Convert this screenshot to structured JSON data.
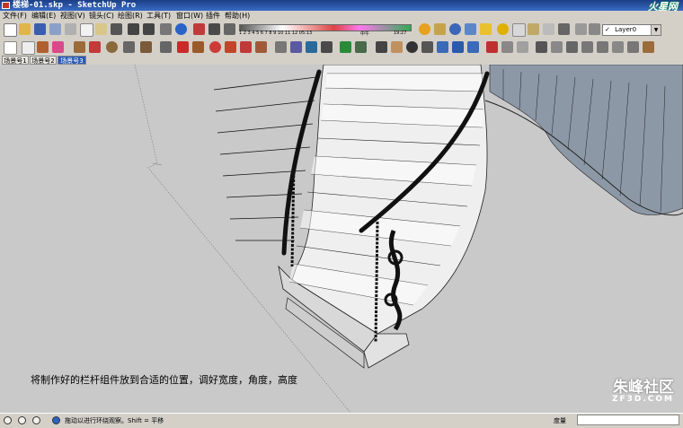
{
  "window": {
    "title": "楼梯-01.skp - SketchUp Pro",
    "watermark": "火星网"
  },
  "menu": [
    "文件(F)",
    "编辑(E)",
    "视图(V)",
    "镜头(C)",
    "绘图(R)",
    "工具(T)",
    "窗口(W)",
    "插件",
    "帮助(H)"
  ],
  "time_scale": {
    "numbers": "1 2 3 4 5 6 7 8 9 10 11 12 05:13",
    "noon": "中午",
    "end": "19:27"
  },
  "layer": {
    "current": "Layer0",
    "check": "✓"
  },
  "tabs": [
    {
      "label": "场景号1",
      "active": false
    },
    {
      "label": "场景号2",
      "active": false
    },
    {
      "label": "场景号3",
      "active": true
    }
  ],
  "caption": "将制作好的栏杆组件放到合适的位置，调好宽度，角度，高度",
  "brand": {
    "name": "朱峰社区",
    "site": "ZF3D.COM"
  },
  "status": {
    "hint": "拖动以进行环绕观察。Shift = 平移",
    "measure_label": "度量",
    "measure_value": ""
  }
}
